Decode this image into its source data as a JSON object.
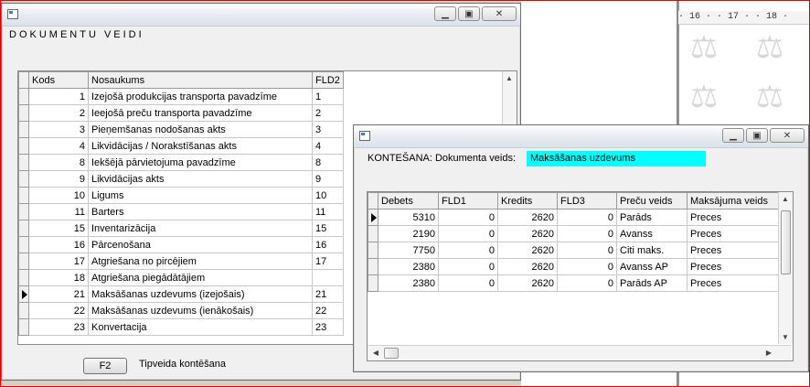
{
  "background_doc": {
    "ruler_text": "· 16 · · 17 · · 18 ·"
  },
  "win1": {
    "section_title": "DOKUMENTU VEIDI",
    "columns": [
      "Kods",
      "Nosaukums",
      "FLD2"
    ],
    "rows": [
      {
        "kods": "1",
        "nosaukums": "Izejošā produkcijas transporta pavadzīme",
        "fld2": "1"
      },
      {
        "kods": "2",
        "nosaukums": "Ieejošā preču transporta pavadzīme",
        "fld2": "2"
      },
      {
        "kods": "3",
        "nosaukums": "Pieņemšanas nodošanas akts",
        "fld2": "3"
      },
      {
        "kods": "4",
        "nosaukums": "Likvidācijas / Norakstīšanas akts",
        "fld2": "4"
      },
      {
        "kods": "8",
        "nosaukums": "Iekšējā pārvietojuma pavadzīme",
        "fld2": "8"
      },
      {
        "kods": "9",
        "nosaukums": "Likvidācijas akts",
        "fld2": "9"
      },
      {
        "kods": "10",
        "nosaukums": "Ligums",
        "fld2": "10"
      },
      {
        "kods": "11",
        "nosaukums": "Barters",
        "fld2": "11"
      },
      {
        "kods": "15",
        "nosaukums": "Inventarizācija",
        "fld2": "15"
      },
      {
        "kods": "16",
        "nosaukums": "Pārcenošana",
        "fld2": "16"
      },
      {
        "kods": "17",
        "nosaukums": "Atgriešana no pircējiem",
        "fld2": "17"
      },
      {
        "kods": "18",
        "nosaukums": "Atgriešana piegādātājiem",
        "fld2": ""
      },
      {
        "kods": "21",
        "nosaukums": "Maksāšanas uzdevums (izejošais)",
        "fld2": "21"
      },
      {
        "kods": "22",
        "nosaukums": "Maksāšanas uzdevums (ienākošais)",
        "fld2": "22"
      },
      {
        "kods": "23",
        "nosaukums": "Konvertacija",
        "fld2": "23"
      }
    ],
    "current_row_index": 12,
    "f2_button_label": "F2",
    "f2_caption": "Tipveida kontēšana"
  },
  "win2": {
    "header_label": "KONTEŠANA: Dokumenta veids:",
    "doc_type_value": "Maksāšanas uzdevums",
    "columns": [
      "Debets",
      "FLD1",
      "Kredits",
      "FLD3",
      "Preču veids",
      "Maksājuma veids"
    ],
    "rows": [
      {
        "debets": "5310",
        "fld1": "0",
        "kredits": "2620",
        "fld3": "0",
        "precu_veids": "Parāds",
        "maksajuma_veids": "Preces"
      },
      {
        "debets": "2190",
        "fld1": "0",
        "kredits": "2620",
        "fld3": "0",
        "precu_veids": "Avanss",
        "maksajuma_veids": "Preces"
      },
      {
        "debets": "7750",
        "fld1": "0",
        "kredits": "2620",
        "fld3": "0",
        "precu_veids": "Citi maks.",
        "maksajuma_veids": "Preces"
      },
      {
        "debets": "2380",
        "fld1": "0",
        "kredits": "2620",
        "fld3": "0",
        "precu_veids": "Avanss AP",
        "maksajuma_veids": "Preces"
      },
      {
        "debets": "2380",
        "fld1": "0",
        "kredits": "2620",
        "fld3": "0",
        "precu_veids": "Parāds AP",
        "maksajuma_veids": "Preces"
      }
    ],
    "current_row_index": 0
  },
  "colors": {
    "highlight_field": "#00ffff",
    "desktop_border": "#e00000"
  }
}
